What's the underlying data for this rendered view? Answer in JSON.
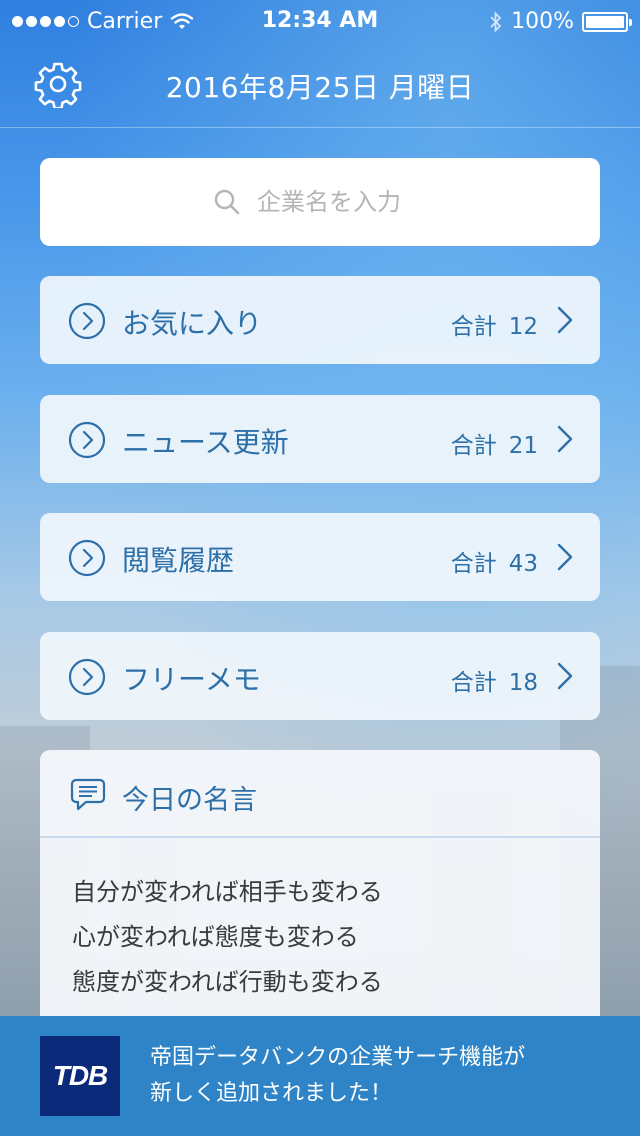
{
  "status_bar": {
    "carrier": "Carrier",
    "time": "12:34 AM",
    "battery": "100%"
  },
  "nav": {
    "date": "2016年8月25日 月曜日"
  },
  "search": {
    "placeholder": "企業名を入力"
  },
  "menu": {
    "count_label": "合計",
    "items": [
      {
        "label": "お気に入り",
        "count": "12"
      },
      {
        "label": "ニュース更新",
        "count": "21"
      },
      {
        "label": "閲覧履歴",
        "count": "43"
      },
      {
        "label": "フリーメモ",
        "count": "18"
      }
    ]
  },
  "quote": {
    "title": "今日の名言",
    "lines": [
      "自分が変われば相手も変わる",
      "心が変われば態度も変わる",
      "態度が変われば行動も変わる"
    ]
  },
  "banner": {
    "logo": "TDB",
    "line1": "帝国データバンクの企業サーチ機能が",
    "line2": "新しく追加されました！"
  },
  "colors": {
    "accent": "#2d6fa8",
    "banner": "#2e84c6",
    "logo_bg": "#0c2a7a"
  },
  "icons": {
    "settings": "gear-icon",
    "search": "search-icon",
    "menu_item": "circle-chevron-right-icon",
    "disclosure": "chevron-right-icon",
    "quote": "speech-bubble-icon",
    "wifi": "wifi-icon",
    "bluetooth": "bluetooth-icon",
    "battery": "battery-icon"
  }
}
